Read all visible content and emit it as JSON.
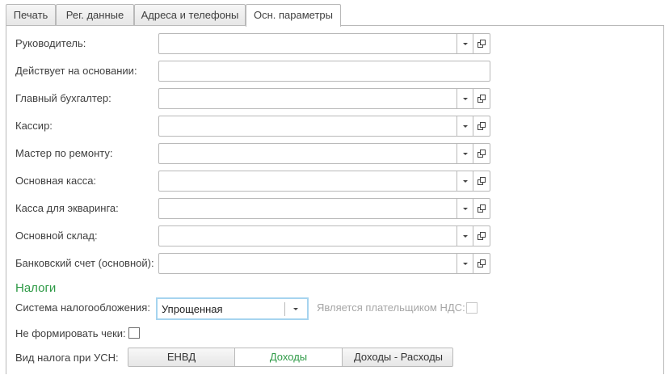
{
  "tabs": [
    {
      "label": "Печать"
    },
    {
      "label": "Рег. данные"
    },
    {
      "label": "Адреса и телефоны"
    },
    {
      "label": "Осн. параметры"
    }
  ],
  "fields": {
    "head": {
      "label": "Руководитель:",
      "value": ""
    },
    "basis": {
      "label": "Действует на основании:",
      "value": ""
    },
    "chief_accountant": {
      "label": "Главный бухгалтер:",
      "value": ""
    },
    "cashier": {
      "label": "Кассир:",
      "value": ""
    },
    "repair_master": {
      "label": "Мастер по ремонту:",
      "value": ""
    },
    "main_cash": {
      "label": "Основная касса:",
      "value": ""
    },
    "acquiring_cash": {
      "label": "Касса для экваринга:",
      "value": ""
    },
    "main_warehouse": {
      "label": "Основной склад:",
      "value": ""
    },
    "bank_account": {
      "label": "Банковский счет (основной):",
      "value": ""
    }
  },
  "taxes": {
    "title": "Налоги",
    "system_label": "Система налогообложения:",
    "system_value": "Упрощенная",
    "vat_payer_label": "Является плательщиком НДС:",
    "vat_payer_checked": false,
    "no_receipts_label": "Не формировать чеки:",
    "no_receipts_checked": false,
    "usn_label": "Вид налога при УСН:",
    "usn_options": [
      "ЕНВД",
      "Доходы",
      "Доходы - Расходы"
    ],
    "usn_selected": "Доходы"
  },
  "colors": {
    "accent_green": "#2e9a46",
    "focus_border": "#a6d4ef",
    "border": "#b9b9b9"
  }
}
